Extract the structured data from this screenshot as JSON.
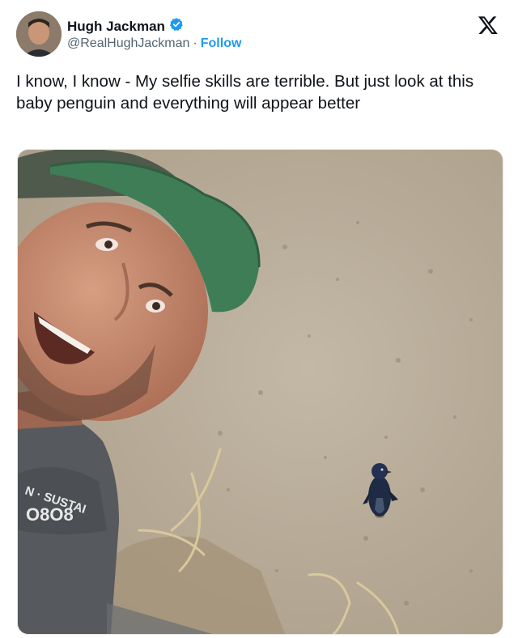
{
  "author": {
    "display_name": "Hugh Jackman",
    "handle": "@RealHughJackman",
    "separator": "·",
    "follow_label": "Follow",
    "verified_icon": "verified-badge-icon"
  },
  "platform_icon": "x-logo-icon",
  "tweet": {
    "text": "I know, I know - My selfie skills are terrible. But just look at this baby penguin and everything will appear better"
  },
  "photo": {
    "shirt_print_line1": "N · SUSTAI",
    "shirt_print_line2": "O8O8"
  },
  "colors": {
    "accent": "#1d9bf0",
    "text": "#0f1419",
    "muted": "#536471",
    "sand": "#b7ab98",
    "cap_green": "#3f7d56"
  }
}
